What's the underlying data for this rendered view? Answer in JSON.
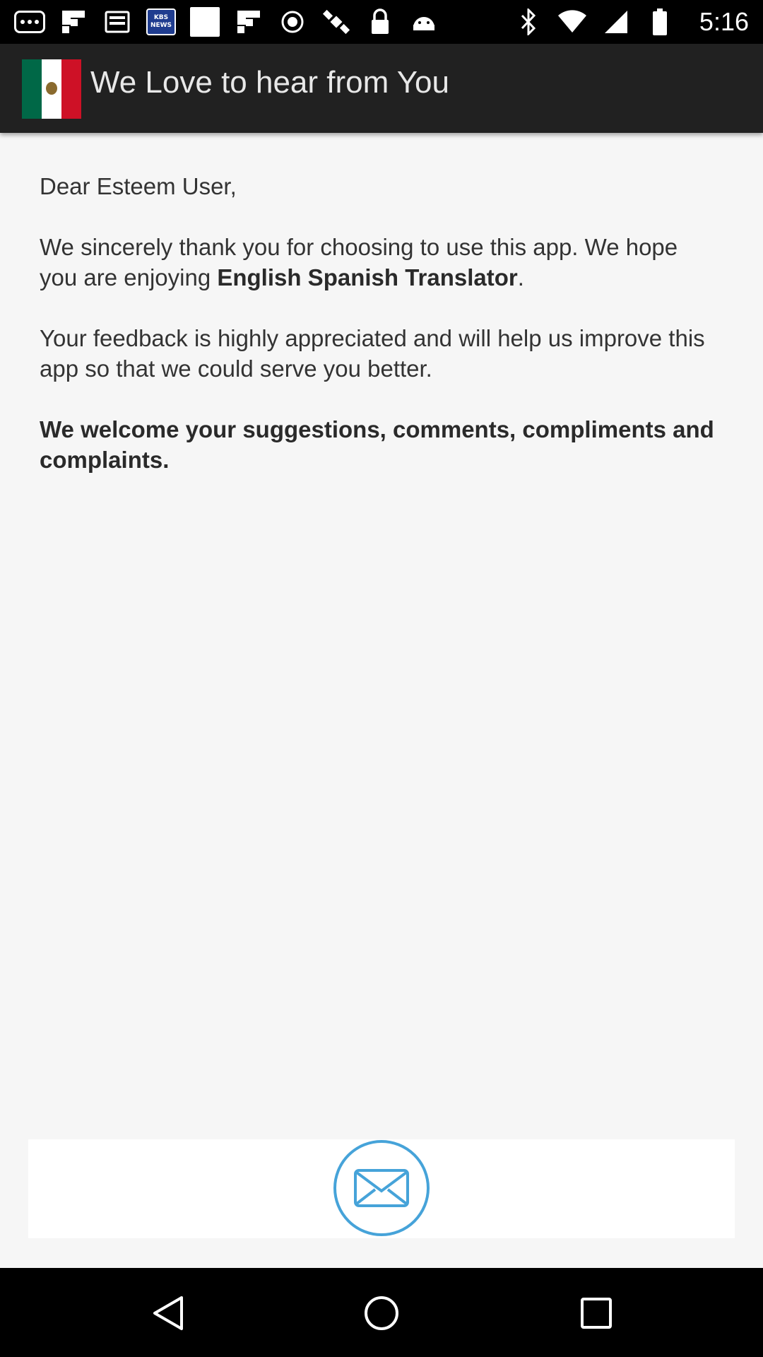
{
  "status_bar": {
    "time": "5:16",
    "left_icons": [
      "message-dots-icon",
      "flipboard-icon",
      "cast-icon",
      "kbs-news-icon",
      "blank-notification-icon",
      "flipboard-icon",
      "sync-icon",
      "satellite-icon",
      "lock-icon",
      "android-icon"
    ],
    "kbs_line1": "KBS",
    "kbs_line2": "NEWS",
    "right_icons": [
      "bluetooth-icon",
      "wifi-icon",
      "signal-icon",
      "battery-icon"
    ]
  },
  "app_bar": {
    "title": "We Love to hear from You",
    "flag_icon": "mexico-flag-icon"
  },
  "content": {
    "greeting": "Dear Esteem User,",
    "para1_prefix": "We sincerely thank you for choosing to use this app. We hope you are enjoying ",
    "para1_bold": "English Spanish Translator",
    "para1_suffix": ".",
    "para2": "Your feedback is highly appreciated and will help us improve this app so that we could serve you better.",
    "para3": "We welcome your suggestions, comments, compliments and complaints."
  },
  "mail_button": {
    "icon": "envelope-icon",
    "color": "#46a3d9"
  },
  "nav_bar": {
    "items": [
      "back-icon",
      "home-icon",
      "recents-icon"
    ]
  },
  "colors": {
    "app_bar": "#212121",
    "background": "#f6f6f6",
    "accent": "#46a3d9"
  }
}
